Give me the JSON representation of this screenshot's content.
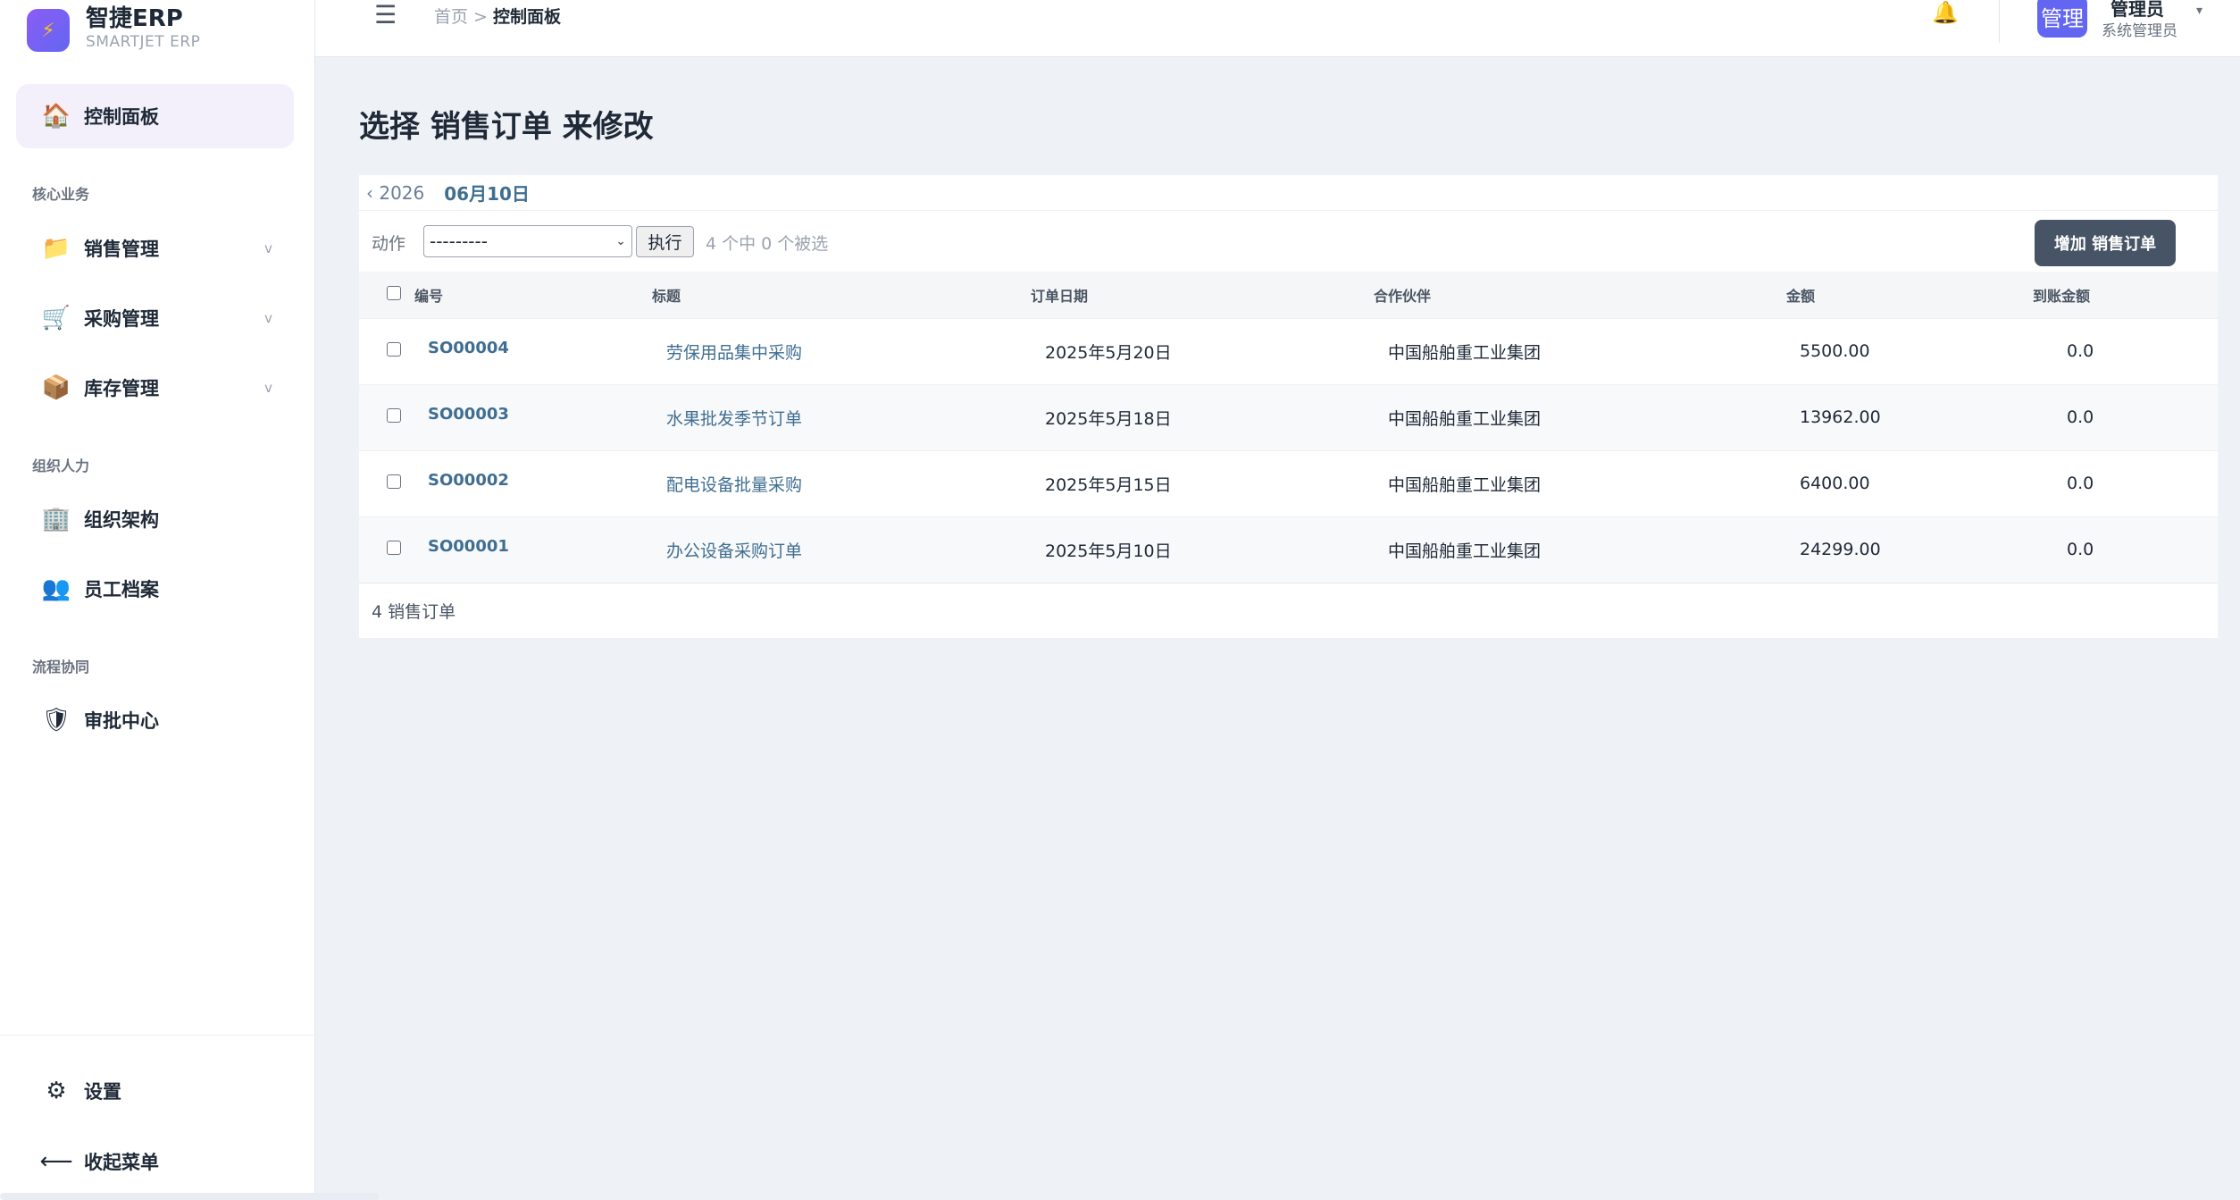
{
  "brand": {
    "title": "智捷ERP",
    "subtitle": "SMARTJET ERP",
    "logo_icon": "lightning-icon"
  },
  "sidebar": {
    "active_item": {
      "label": "控制面板",
      "icon": "home-icon"
    },
    "sections": [
      {
        "label": "核心业务"
      },
      {
        "label": "组织人力"
      },
      {
        "label": "流程协同"
      }
    ],
    "items": [
      {
        "label": "销售管理",
        "icon": "folder-icon",
        "chevron": "v"
      },
      {
        "label": "采购管理",
        "icon": "cart-icon",
        "chevron": "v"
      },
      {
        "label": "库存管理",
        "icon": "box-icon",
        "chevron": "v"
      },
      {
        "label": "组织架构",
        "icon": "building-icon"
      },
      {
        "label": "员工档案",
        "icon": "people-icon"
      },
      {
        "label": "审批中心",
        "icon": "shield-icon"
      }
    ],
    "bottom": [
      {
        "label": "设置",
        "icon": "gear-icon"
      },
      {
        "label": "收起菜单",
        "icon": "arrow-left-icon"
      }
    ]
  },
  "header": {
    "menu_icon": "☰",
    "breadcrumb": {
      "home": "首页",
      "separator": ">",
      "current": "控制面板"
    },
    "bell_icon": "🔔",
    "user": {
      "avatar_text": "管理",
      "name": "管理员",
      "role": "系统管理员",
      "caret": "▾"
    }
  },
  "main": {
    "title": "选择 销售订单 来修改",
    "date_nav": {
      "back": "‹ 2026",
      "current": "06月10日"
    },
    "actions": {
      "label": "动作",
      "select_value": "---------",
      "go_label": "执行",
      "counter": "4 个中 0 个被选",
      "add_label": "增加 销售订单"
    },
    "table": {
      "columns": [
        "编号",
        "标题",
        "订单日期",
        "合作伙伴",
        "金额",
        "到账金额"
      ],
      "rows": [
        {
          "code": "SO00004",
          "title": "劳保用品集中采购",
          "date": "2025年5月20日",
          "partner": "中国船舶重工业集团",
          "amount": "5500.00",
          "received": "0.0"
        },
        {
          "code": "SO00003",
          "title": "水果批发季节订单",
          "date": "2025年5月18日",
          "partner": "中国船舶重工业集团",
          "amount": "13962.00",
          "received": "0.0"
        },
        {
          "code": "SO00002",
          "title": "配电设备批量采购",
          "date": "2025年5月15日",
          "partner": "中国船舶重工业集团",
          "amount": "6400.00",
          "received": "0.0"
        },
        {
          "code": "SO00001",
          "title": "办公设备采购订单",
          "date": "2025年5月10日",
          "partner": "中国船舶重工业集团",
          "amount": "24299.00",
          "received": "0.0"
        }
      ]
    },
    "result_count": "4 销售订单"
  }
}
